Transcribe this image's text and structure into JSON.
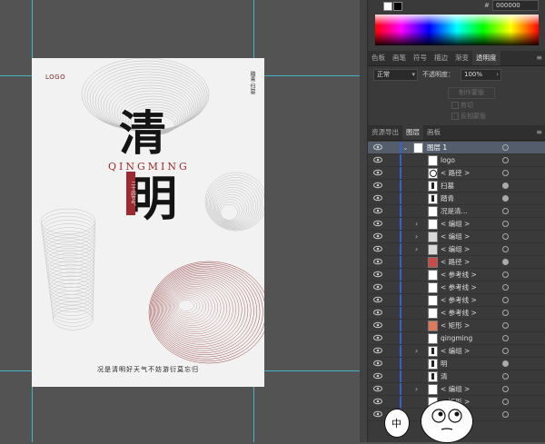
{
  "color_panel": {
    "hex_value": "000000",
    "hex_prefix": "#"
  },
  "panel_tabs_1": [
    "色板",
    "画笔",
    "符号",
    "描边",
    "渐变",
    "透明度"
  ],
  "transparency": {
    "blend_mode": "正常",
    "opacity_label": "不透明度：",
    "opacity_value": "100%",
    "make_mask": "制作蒙版",
    "clip": "剪切",
    "invert_mask": "反相蒙版"
  },
  "panel_tabs_2": [
    "资源导出",
    "图层",
    "画板"
  ],
  "layers": {
    "top_layer": "图层 1",
    "items": [
      {
        "name": "logo",
        "expand": false,
        "thumb": "white",
        "target": "open"
      },
      {
        "name": "< 路径 >",
        "expand": false,
        "thumb": "circle",
        "target": "open"
      },
      {
        "name": "扫墓",
        "expand": false,
        "thumb": "figure",
        "target": "fill"
      },
      {
        "name": "踏青",
        "expand": false,
        "thumb": "figure",
        "target": "fill"
      },
      {
        "name": "况是清...",
        "expand": false,
        "thumb": "white",
        "target": "open"
      },
      {
        "name": "< 编组 >",
        "expand": true,
        "thumb": "white",
        "target": "open"
      },
      {
        "name": "< 编组 >",
        "expand": true,
        "thumb": "gray",
        "target": "open"
      },
      {
        "name": "< 编组 >",
        "expand": true,
        "thumb": "gray",
        "target": "open"
      },
      {
        "name": "< 路径 >",
        "expand": false,
        "thumb": "red",
        "target": "fill"
      },
      {
        "name": "< 参考线 >",
        "expand": false,
        "thumb": "white",
        "target": "open"
      },
      {
        "name": "< 参考线 >",
        "expand": false,
        "thumb": "white",
        "target": "open"
      },
      {
        "name": "< 参考线 >",
        "expand": false,
        "thumb": "white",
        "target": "open"
      },
      {
        "name": "< 参考线 >",
        "expand": false,
        "thumb": "white",
        "target": "open"
      },
      {
        "name": "< 矩形 >",
        "expand": false,
        "thumb": "orange",
        "target": "open"
      },
      {
        "name": "qingming",
        "expand": false,
        "thumb": "white",
        "target": "open"
      },
      {
        "name": "< 编组 >",
        "expand": true,
        "thumb": "figure",
        "target": "open"
      },
      {
        "name": "明",
        "expand": false,
        "thumb": "figure",
        "target": "fill"
      },
      {
        "name": "清",
        "expand": false,
        "thumb": "figure",
        "target": "open"
      },
      {
        "name": "< 编组 >",
        "expand": true,
        "thumb": "white",
        "target": "open"
      },
      {
        "name": "< 矩形 >",
        "expand": false,
        "thumb": "white",
        "target": "open"
      },
      {
        "name": "< 矩形 >",
        "expand": false,
        "thumb": "orange",
        "target": "open"
      }
    ]
  },
  "artboard": {
    "logo": "LOGO",
    "vertical_text": "踏青·扫墓",
    "char_1": "清",
    "char_2": "明",
    "pinyin": "QINGMING",
    "seal_text": "二十四节气",
    "bottom_line": "况是清明好天气不妨游衍莫忘归"
  },
  "stickers": {
    "left_text": "中",
    "colors": {
      "bubble": "#ffffff"
    }
  },
  "colors": {
    "canvas_bg": "#535353",
    "panel_bg": "#3a3a3a",
    "guide": "#3fd4e8",
    "accent_red": "#9e2a2f",
    "selected_layer": "#545d6b"
  }
}
